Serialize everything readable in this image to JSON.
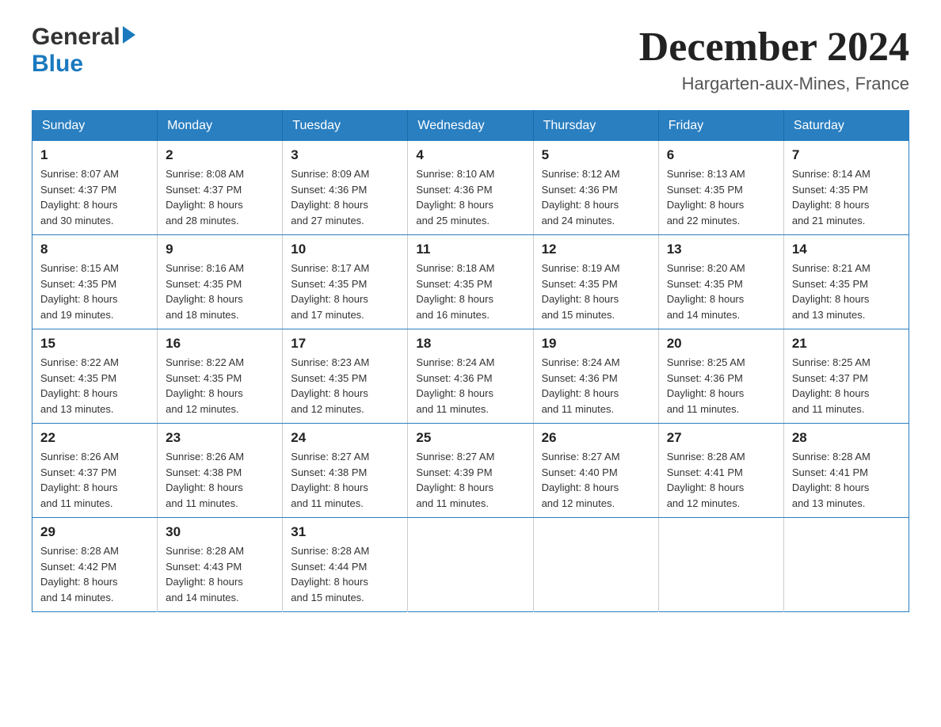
{
  "logo": {
    "text_general": "General",
    "text_blue": "Blue",
    "triangle": "▶"
  },
  "header": {
    "month_year": "December 2024",
    "location": "Hargarten-aux-Mines, France"
  },
  "weekdays": [
    "Sunday",
    "Monday",
    "Tuesday",
    "Wednesday",
    "Thursday",
    "Friday",
    "Saturday"
  ],
  "weeks": [
    [
      {
        "day": "1",
        "info": "Sunrise: 8:07 AM\nSunset: 4:37 PM\nDaylight: 8 hours\nand 30 minutes."
      },
      {
        "day": "2",
        "info": "Sunrise: 8:08 AM\nSunset: 4:37 PM\nDaylight: 8 hours\nand 28 minutes."
      },
      {
        "day": "3",
        "info": "Sunrise: 8:09 AM\nSunset: 4:36 PM\nDaylight: 8 hours\nand 27 minutes."
      },
      {
        "day": "4",
        "info": "Sunrise: 8:10 AM\nSunset: 4:36 PM\nDaylight: 8 hours\nand 25 minutes."
      },
      {
        "day": "5",
        "info": "Sunrise: 8:12 AM\nSunset: 4:36 PM\nDaylight: 8 hours\nand 24 minutes."
      },
      {
        "day": "6",
        "info": "Sunrise: 8:13 AM\nSunset: 4:35 PM\nDaylight: 8 hours\nand 22 minutes."
      },
      {
        "day": "7",
        "info": "Sunrise: 8:14 AM\nSunset: 4:35 PM\nDaylight: 8 hours\nand 21 minutes."
      }
    ],
    [
      {
        "day": "8",
        "info": "Sunrise: 8:15 AM\nSunset: 4:35 PM\nDaylight: 8 hours\nand 19 minutes."
      },
      {
        "day": "9",
        "info": "Sunrise: 8:16 AM\nSunset: 4:35 PM\nDaylight: 8 hours\nand 18 minutes."
      },
      {
        "day": "10",
        "info": "Sunrise: 8:17 AM\nSunset: 4:35 PM\nDaylight: 8 hours\nand 17 minutes."
      },
      {
        "day": "11",
        "info": "Sunrise: 8:18 AM\nSunset: 4:35 PM\nDaylight: 8 hours\nand 16 minutes."
      },
      {
        "day": "12",
        "info": "Sunrise: 8:19 AM\nSunset: 4:35 PM\nDaylight: 8 hours\nand 15 minutes."
      },
      {
        "day": "13",
        "info": "Sunrise: 8:20 AM\nSunset: 4:35 PM\nDaylight: 8 hours\nand 14 minutes."
      },
      {
        "day": "14",
        "info": "Sunrise: 8:21 AM\nSunset: 4:35 PM\nDaylight: 8 hours\nand 13 minutes."
      }
    ],
    [
      {
        "day": "15",
        "info": "Sunrise: 8:22 AM\nSunset: 4:35 PM\nDaylight: 8 hours\nand 13 minutes."
      },
      {
        "day": "16",
        "info": "Sunrise: 8:22 AM\nSunset: 4:35 PM\nDaylight: 8 hours\nand 12 minutes."
      },
      {
        "day": "17",
        "info": "Sunrise: 8:23 AM\nSunset: 4:35 PM\nDaylight: 8 hours\nand 12 minutes."
      },
      {
        "day": "18",
        "info": "Sunrise: 8:24 AM\nSunset: 4:36 PM\nDaylight: 8 hours\nand 11 minutes."
      },
      {
        "day": "19",
        "info": "Sunrise: 8:24 AM\nSunset: 4:36 PM\nDaylight: 8 hours\nand 11 minutes."
      },
      {
        "day": "20",
        "info": "Sunrise: 8:25 AM\nSunset: 4:36 PM\nDaylight: 8 hours\nand 11 minutes."
      },
      {
        "day": "21",
        "info": "Sunrise: 8:25 AM\nSunset: 4:37 PM\nDaylight: 8 hours\nand 11 minutes."
      }
    ],
    [
      {
        "day": "22",
        "info": "Sunrise: 8:26 AM\nSunset: 4:37 PM\nDaylight: 8 hours\nand 11 minutes."
      },
      {
        "day": "23",
        "info": "Sunrise: 8:26 AM\nSunset: 4:38 PM\nDaylight: 8 hours\nand 11 minutes."
      },
      {
        "day": "24",
        "info": "Sunrise: 8:27 AM\nSunset: 4:38 PM\nDaylight: 8 hours\nand 11 minutes."
      },
      {
        "day": "25",
        "info": "Sunrise: 8:27 AM\nSunset: 4:39 PM\nDaylight: 8 hours\nand 11 minutes."
      },
      {
        "day": "26",
        "info": "Sunrise: 8:27 AM\nSunset: 4:40 PM\nDaylight: 8 hours\nand 12 minutes."
      },
      {
        "day": "27",
        "info": "Sunrise: 8:28 AM\nSunset: 4:41 PM\nDaylight: 8 hours\nand 12 minutes."
      },
      {
        "day": "28",
        "info": "Sunrise: 8:28 AM\nSunset: 4:41 PM\nDaylight: 8 hours\nand 13 minutes."
      }
    ],
    [
      {
        "day": "29",
        "info": "Sunrise: 8:28 AM\nSunset: 4:42 PM\nDaylight: 8 hours\nand 14 minutes."
      },
      {
        "day": "30",
        "info": "Sunrise: 8:28 AM\nSunset: 4:43 PM\nDaylight: 8 hours\nand 14 minutes."
      },
      {
        "day": "31",
        "info": "Sunrise: 8:28 AM\nSunset: 4:44 PM\nDaylight: 8 hours\nand 15 minutes."
      },
      null,
      null,
      null,
      null
    ]
  ]
}
